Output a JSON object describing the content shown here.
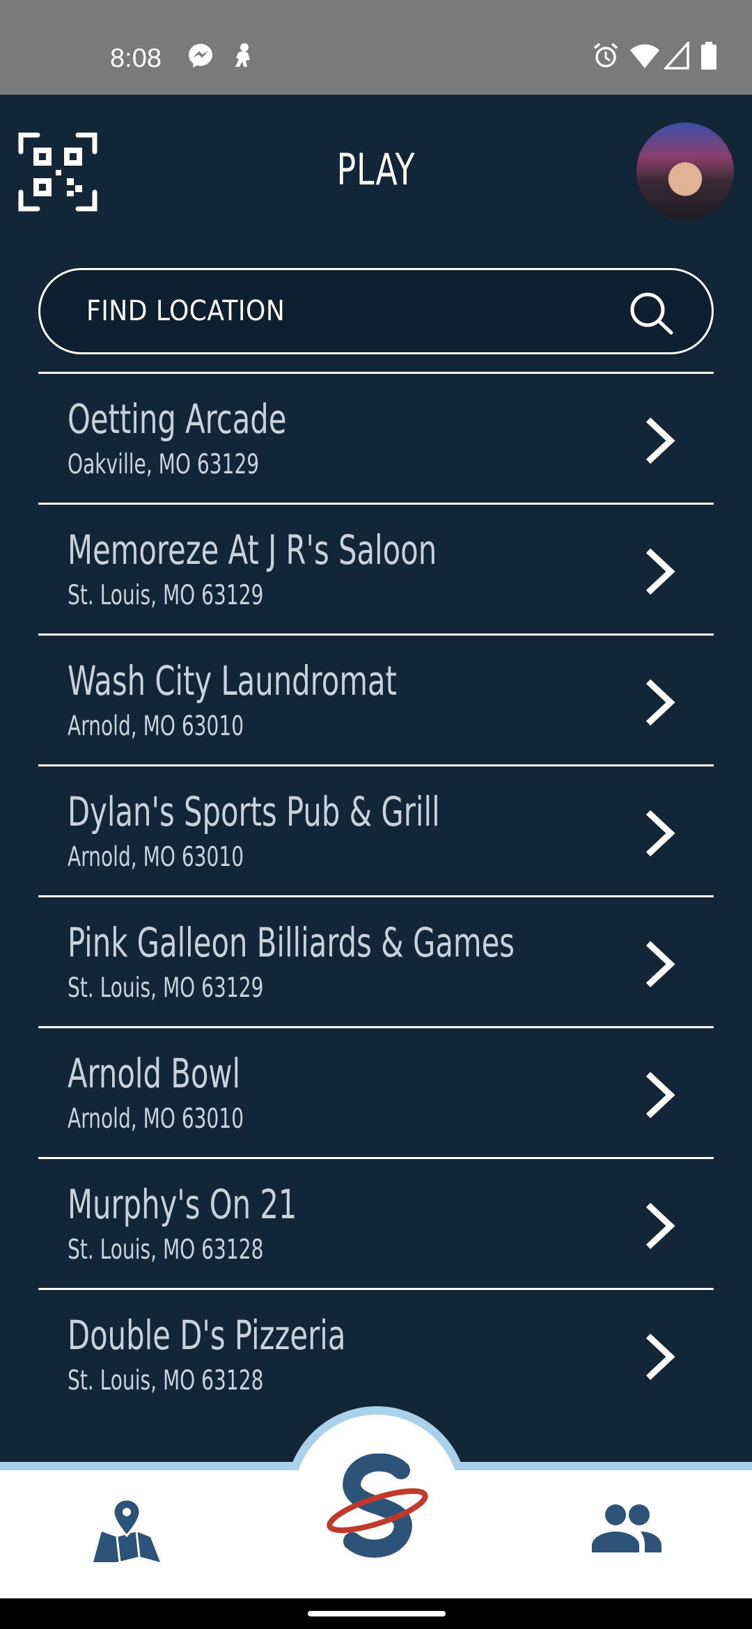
{
  "status_bar": {
    "time": "8:08",
    "left_icons": [
      "messenger-icon",
      "notification-icon"
    ],
    "right_icons": [
      "alarm-icon",
      "wifi-icon",
      "signal-icon",
      "battery-icon"
    ]
  },
  "header": {
    "title": "PLAY",
    "qr_icon": "qr-code-icon",
    "avatar": "profile-avatar"
  },
  "search": {
    "placeholder": "FIND LOCATION",
    "value": "",
    "icon": "search-icon"
  },
  "locations": [
    {
      "name": "Oetting Arcade",
      "address": "Oakville, MO 63129"
    },
    {
      "name": "Memoreze At J R's Saloon",
      "address": "St. Louis, MO 63129"
    },
    {
      "name": "Wash City Laundromat",
      "address": "Arnold, MO 63010"
    },
    {
      "name": "Dylan's Sports Pub & Grill",
      "address": "Arnold, MO 63010"
    },
    {
      "name": "Pink Galleon Billiards & Games",
      "address": "St. Louis, MO 63129"
    },
    {
      "name": "Arnold Bowl",
      "address": "Arnold, MO 63010"
    },
    {
      "name": "Murphy's On 21",
      "address": "St. Louis, MO 63128"
    },
    {
      "name": "Double D's Pizzeria",
      "address": "St. Louis, MO 63128"
    }
  ],
  "bottom_nav": {
    "items": [
      "map-icon",
      "app-logo-icon",
      "friends-icon"
    ]
  },
  "colors": {
    "background": "#122638",
    "text": "#c9d2da",
    "accent": "#a9d1ea",
    "nav_icon": "#2d5378",
    "logo_red": "#c0392b"
  }
}
